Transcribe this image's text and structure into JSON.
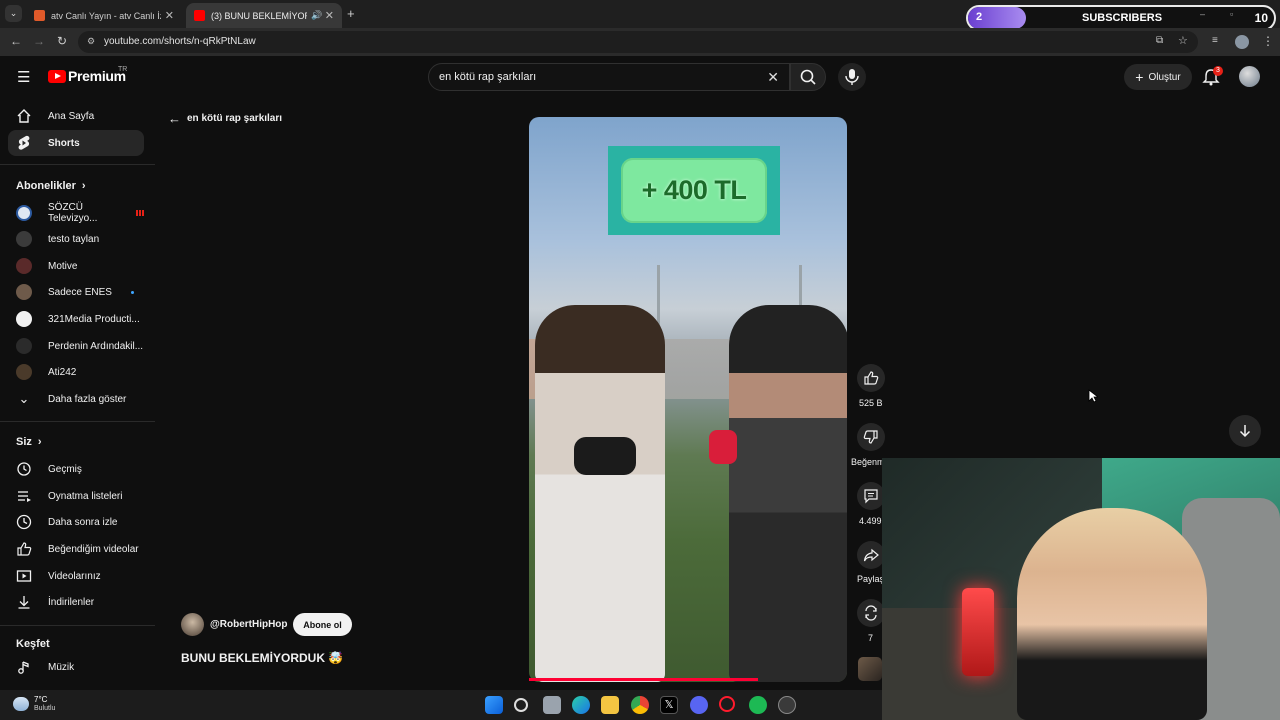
{
  "browser": {
    "tabs": [
      {
        "title": "atv Canlı Yayın - atv Canlı İzle -",
        "active": false
      },
      {
        "title": "(3) BUNU BEKLEMİYORDUK",
        "active": true
      }
    ],
    "url": "youtube.com/shorts/n-qRkPtNLaw"
  },
  "stream_widget": {
    "count": "2",
    "label": "SUBSCRIBERS",
    "goal": "10"
  },
  "youtube": {
    "logo_text": "Premium",
    "logo_region": "TR",
    "search": {
      "value": "en kötü rap şarkıları"
    },
    "create_label": "Oluştur",
    "notification_count": "3"
  },
  "sidebar": {
    "main": [
      {
        "label": "Ana Sayfa",
        "icon": "home-icon"
      },
      {
        "label": "Shorts",
        "icon": "shorts-icon",
        "active": true
      }
    ],
    "subscriptions_heading": "Abonelikler",
    "subscriptions": [
      {
        "label": "SÖZCÜ Televizyo...",
        "live": true
      },
      {
        "label": "testo taylan"
      },
      {
        "label": "Motive"
      },
      {
        "label": "Sadece ENES",
        "new": true
      },
      {
        "label": "321Media Producti..."
      },
      {
        "label": "Perdenin Ardındakil..."
      },
      {
        "label": "Ati242"
      }
    ],
    "show_more": "Daha fazla göster",
    "you_heading": "Siz",
    "you": [
      {
        "label": "Geçmiş",
        "icon": "history-icon"
      },
      {
        "label": "Oynatma listeleri",
        "icon": "playlists-icon"
      },
      {
        "label": "Daha sonra izle",
        "icon": "watch-later-icon"
      },
      {
        "label": "Beğendiğim videolar",
        "icon": "liked-icon"
      },
      {
        "label": "Videolarınız",
        "icon": "your-videos-icon"
      },
      {
        "label": "İndirilenler",
        "icon": "downloads-icon"
      }
    ],
    "explore_heading": "Keşfet",
    "explore": [
      {
        "label": "Müzik",
        "icon": "music-icon"
      }
    ]
  },
  "short": {
    "back_query": "en kötü rap şarkıları",
    "banner_text": "+ 400 TL",
    "channel": "@RobertHipHop",
    "subscribe_label": "Abone ol",
    "title": "BUNU BEKLEMİYORDUK 🤯",
    "progress_fraction": 0.72,
    "actions": {
      "likes": "525 B",
      "dislike_label": "Beğenme",
      "comments": "4.499",
      "share_label": "Paylaş",
      "remix_count": "7"
    }
  },
  "taskbar": {
    "weather_temp": "7°C",
    "weather_cond": "Bulutlu"
  }
}
